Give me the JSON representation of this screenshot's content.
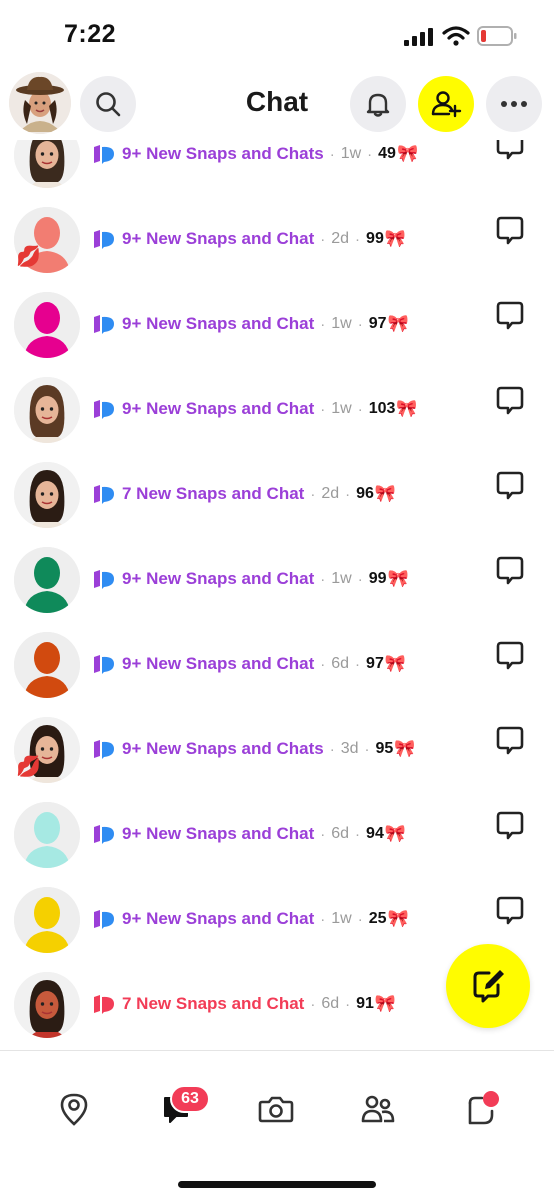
{
  "status_bar": {
    "time": "7:22",
    "signal_icon": "signal-icon",
    "wifi_icon": "wifi-icon",
    "battery_icon": "battery-low-icon",
    "battery_color": "#e53935"
  },
  "header": {
    "title": "Chat",
    "avatar_icon": "bitmoji-avatar",
    "search_icon": "search-icon",
    "bell_icon": "bell-icon",
    "add_friend_icon": "add-friend-icon",
    "more_icon": "more-icon",
    "accent": "#fffc00"
  },
  "chats": [
    {
      "status": "9+ New Snaps and Chats",
      "dot": "·",
      "age": "1w",
      "streak": "49",
      "bow": "🎀",
      "avatar_color": "#ffffff",
      "avatar_kind": "bitmoji",
      "kiss": "",
      "status_color": "#9b3fd8"
    },
    {
      "status": "9+ New Snaps and Chat",
      "dot": "·",
      "age": "2d",
      "streak": "99",
      "bow": "🎀",
      "avatar_color": "#f27d72",
      "avatar_kind": "silhouette",
      "kiss": "💋",
      "status_color": "#9b3fd8"
    },
    {
      "status": "9+ New Snaps and Chat",
      "dot": "·",
      "age": "1w",
      "streak": "97",
      "bow": "🎀",
      "avatar_color": "#e6008f",
      "avatar_kind": "silhouette",
      "kiss": "",
      "status_color": "#9b3fd8"
    },
    {
      "status": "9+ New Snaps and Chat",
      "dot": "·",
      "age": "1w",
      "streak": "103",
      "bow": "🎀",
      "avatar_color": "#ffffff",
      "avatar_kind": "bitmoji",
      "kiss": "",
      "status_color": "#9b3fd8"
    },
    {
      "status": "7 New Snaps and Chat",
      "dot": "·",
      "age": "2d",
      "streak": "96",
      "bow": "🎀",
      "avatar_color": "#ffffff",
      "avatar_kind": "bitmoji",
      "kiss": "",
      "status_color": "#9b3fd8"
    },
    {
      "status": "9+ New Snaps and Chat",
      "dot": "·",
      "age": "1w",
      "streak": "99",
      "bow": "🎀",
      "avatar_color": "#0f8a5a",
      "avatar_kind": "silhouette",
      "kiss": "",
      "status_color": "#9b3fd8"
    },
    {
      "status": "9+ New Snaps and Chat",
      "dot": "·",
      "age": "6d",
      "streak": "97",
      "bow": "🎀",
      "avatar_color": "#d14a0f",
      "avatar_kind": "silhouette",
      "kiss": "",
      "status_color": "#9b3fd8"
    },
    {
      "status": "9+ New Snaps and Chats",
      "dot": "·",
      "age": "3d",
      "streak": "95",
      "bow": "🎀",
      "avatar_color": "#ffffff",
      "avatar_kind": "bitmoji",
      "kiss": "💋",
      "status_color": "#9b3fd8"
    },
    {
      "status": "9+ New Snaps and Chat",
      "dot": "·",
      "age": "6d",
      "streak": "94",
      "bow": "🎀",
      "avatar_color": "#a6e9e3",
      "avatar_kind": "silhouette",
      "kiss": "",
      "status_color": "#9b3fd8"
    },
    {
      "status": "9+ New Snaps and Chat",
      "dot": "·",
      "age": "1w",
      "streak": "25",
      "bow": "🎀",
      "avatar_color": "#f5d000",
      "avatar_kind": "silhouette",
      "kiss": "",
      "status_color": "#9b3fd8"
    },
    {
      "status": "7 New Snaps and Chat",
      "dot": "·",
      "age": "6d",
      "streak": "91",
      "bow": "🎀",
      "avatar_color": "#ffffff",
      "avatar_kind": "bitmoji",
      "kiss": "",
      "status_color": "#f23c57"
    }
  ],
  "fab": {
    "icon": "new-chat-icon"
  },
  "bottom_nav": {
    "map_icon": "map-pin-icon",
    "chat_icon": "chat-icon",
    "chat_badge": "63",
    "camera_icon": "camera-icon",
    "friends_icon": "friends-icon",
    "stories_icon": "stories-icon"
  }
}
